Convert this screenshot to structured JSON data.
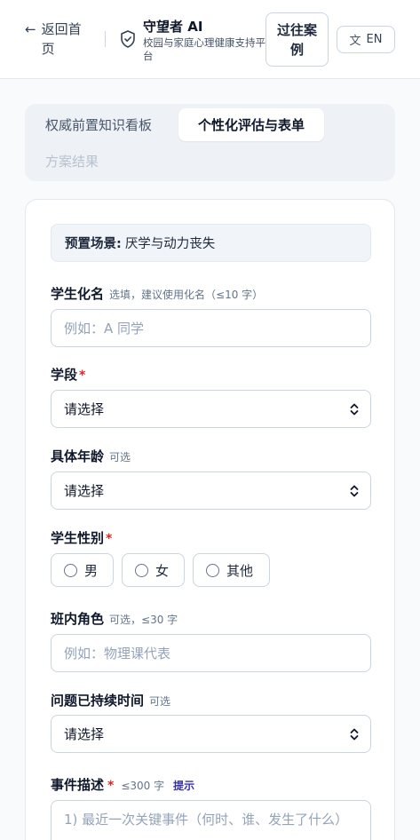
{
  "header": {
    "back_label": "返回首页",
    "brand_title": "守望者 AI",
    "brand_subtitle": "校园与家庭心理健康支持平台",
    "cases_button": "过往案例",
    "lang_button": "EN"
  },
  "tabs": [
    {
      "label": "权威前置知识看板",
      "active": false
    },
    {
      "label": "个性化评估与表单",
      "active": true
    },
    {
      "label": "方案结果",
      "active": false,
      "disabled": true
    }
  ],
  "form": {
    "scene_label": "预置场景:",
    "scene_value": "厌学与动力丧失",
    "name": {
      "label": "学生化名",
      "hint": "选填，建议使用化名（≤10 字）",
      "placeholder": "例如：A 同学"
    },
    "stage": {
      "label": "学段",
      "required_mark": "*",
      "value": "请选择"
    },
    "age": {
      "label": "具体年龄",
      "hint": "可选",
      "value": "请选择"
    },
    "gender": {
      "label": "学生性别",
      "required_mark": "*",
      "options": [
        "男",
        "女",
        "其他"
      ]
    },
    "role": {
      "label": "班内角色",
      "hint": "可选，≤30 字",
      "placeholder": "例如：物理课代表"
    },
    "duration": {
      "label": "问题已持续时间",
      "hint": "可选",
      "value": "请选择"
    },
    "event": {
      "label": "事件描述",
      "required_mark": "*",
      "hint": "≤300 字",
      "tip": "提示",
      "placeholder": "1) 最近一次关键事件（何时、谁、发生了什么）"
    }
  },
  "colors": {
    "accent": "#3730a3",
    "required": "#dc2626",
    "page_bg": "#f8fafc"
  }
}
